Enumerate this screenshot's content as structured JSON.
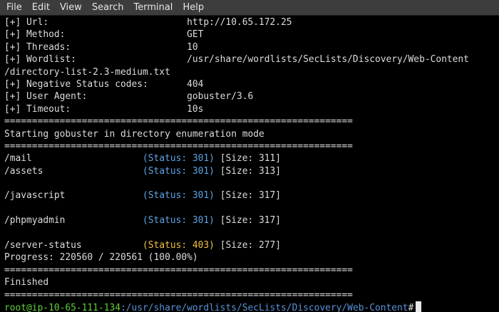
{
  "menu": [
    "File",
    "Edit",
    "View",
    "Search",
    "Terminal",
    "Help"
  ],
  "config": [
    {
      "label": "[+] Url:",
      "value": "http://10.65.172.25"
    },
    {
      "label": "[+] Method:",
      "value": "GET"
    },
    {
      "label": "[+] Threads:",
      "value": "10"
    },
    {
      "label": "[+] Wordlist:",
      "value": "/usr/share/wordlists/SecLists/Discovery/Web-Content",
      "continuation": "/directory-list-2.3-medium.txt"
    },
    {
      "label": "[+] Negative Status codes:",
      "value": "404"
    },
    {
      "label": "[+] User Agent:",
      "value": "gobuster/3.6"
    },
    {
      "label": "[+] Timeout:",
      "value": "10s"
    }
  ],
  "separator": "===============================================================",
  "start_message": "Starting gobuster in directory enumeration mode",
  "results": [
    {
      "path": "/mail",
      "status": "(Status: 301)",
      "size": "[Size: 311]",
      "code": 301
    },
    {
      "path": "/assets",
      "status": "(Status: 301)",
      "size": "[Size: 313]",
      "code": 301
    },
    {
      "path": "/javascript",
      "status": "(Status: 301)",
      "size": "[Size: 317]",
      "code": 301
    },
    {
      "path": "/phpmyadmin",
      "status": "(Status: 301)",
      "size": "[Size: 317]",
      "code": 301
    },
    {
      "path": "/server-status",
      "status": "(Status: 403)",
      "size": "[Size: 277]",
      "code": 403
    }
  ],
  "progress": "Progress: 220560 / 220561 (100.00%)",
  "finished": "Finished",
  "prompt": {
    "user_host": "root@ip-10-65-111-134",
    "path": ":/usr/share/wordlists/SecLists/Discovery/Web-Content",
    "symbol": "#"
  },
  "colors": {
    "status_301": "#5ea3e3",
    "status_403": "#f0c240",
    "prompt_user": "#5fcf3a",
    "prompt_path": "#5a92d8"
  }
}
